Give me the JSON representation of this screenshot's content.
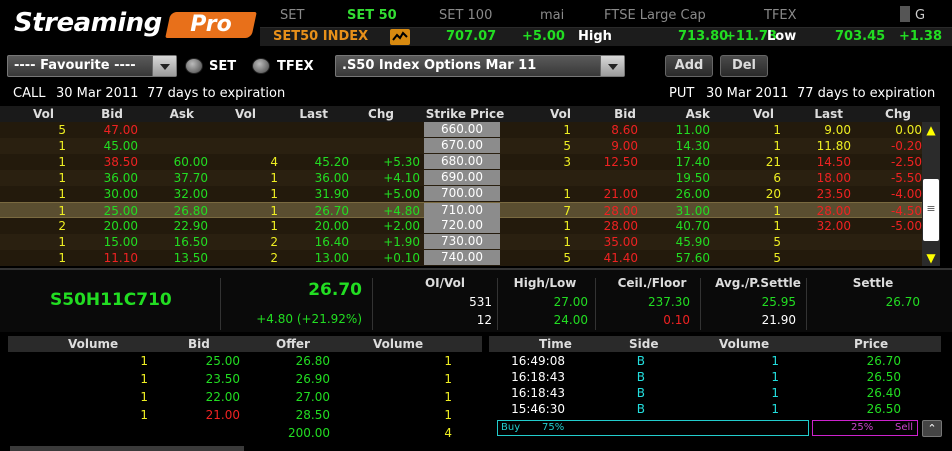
{
  "header": {
    "logo_text": "Streaming",
    "logo_pro": "Pro",
    "tabs": [
      "SET",
      "SET 50",
      "SET 100",
      "mai",
      "FTSE Large Cap",
      "TFEX"
    ],
    "corner_label": "G"
  },
  "ticker": {
    "index_name": "SET50 INDEX",
    "last": "707.07",
    "change": "+5.00",
    "high_label": "High",
    "high": "713.80",
    "high_change": "+11.73",
    "low_label": "Low",
    "low": "703.45",
    "low_change": "+1.38"
  },
  "toolbar": {
    "favourite": "---- Favourite ----",
    "radio_set": "SET",
    "radio_tfex": "TFEX",
    "series": ".S50 Index Options Mar 11",
    "add_label": "Add",
    "del_label": "Del"
  },
  "info": {
    "call_label": "CALL",
    "call_date": "30 Mar 2011",
    "call_days": "77 days to expiration",
    "put_label": "PUT",
    "put_date": "30 Mar 2011",
    "put_days": "77 days to expiration"
  },
  "chain_headers": [
    "Vol",
    "Bid",
    "Ask",
    "Vol",
    "Last",
    "Chg",
    "Strike Price",
    "Vol",
    "Bid",
    "Ask",
    "Vol",
    "Last",
    "Chg"
  ],
  "chain_rows": [
    {
      "c_vol1": "5",
      "c_bid": "47.00",
      "c_ask": "",
      "c_vol2": "",
      "c_last": "",
      "c_chg": "",
      "strike": "660.00",
      "p_vol1": "1",
      "p_bid": "8.60",
      "p_ask": "11.00",
      "p_vol2": "1",
      "p_last": "9.00",
      "p_chg": "0.00"
    },
    {
      "c_vol1": "1",
      "c_bid": "45.00",
      "c_ask": "",
      "c_vol2": "",
      "c_last": "",
      "c_chg": "",
      "strike": "670.00",
      "p_vol1": "5",
      "p_bid": "9.00",
      "p_ask": "14.30",
      "p_vol2": "1",
      "p_last": "11.80",
      "p_chg": "-0.20"
    },
    {
      "c_vol1": "1",
      "c_bid": "38.50",
      "c_ask": "60.00",
      "c_vol2": "4",
      "c_last": "45.20",
      "c_chg": "+5.30",
      "strike": "680.00",
      "p_vol1": "3",
      "p_bid": "12.50",
      "p_ask": "17.40",
      "p_vol2": "21",
      "p_last": "14.50",
      "p_chg": "-2.50"
    },
    {
      "c_vol1": "1",
      "c_bid": "36.00",
      "c_ask": "37.70",
      "c_vol2": "1",
      "c_last": "36.00",
      "c_chg": "+4.10",
      "strike": "690.00",
      "p_vol1": "",
      "p_bid": "",
      "p_ask": "19.50",
      "p_vol2": "6",
      "p_last": "18.00",
      "p_chg": "-5.50"
    },
    {
      "c_vol1": "1",
      "c_bid": "30.00",
      "c_ask": "32.00",
      "c_vol2": "1",
      "c_last": "31.90",
      "c_chg": "+5.00",
      "strike": "700.00",
      "p_vol1": "1",
      "p_bid": "21.00",
      "p_ask": "26.00",
      "p_vol2": "20",
      "p_last": "23.50",
      "p_chg": "-4.00"
    },
    {
      "c_vol1": "1",
      "c_bid": "25.00",
      "c_ask": "26.80",
      "c_vol2": "1",
      "c_last": "26.70",
      "c_chg": "+4.80",
      "strike": "710.00",
      "p_vol1": "7",
      "p_bid": "28.00",
      "p_ask": "31.00",
      "p_vol2": "1",
      "p_last": "28.00",
      "p_chg": "-4.50"
    },
    {
      "c_vol1": "2",
      "c_bid": "20.00",
      "c_ask": "22.90",
      "c_vol2": "1",
      "c_last": "20.00",
      "c_chg": "+2.00",
      "strike": "720.00",
      "p_vol1": "1",
      "p_bid": "28.00",
      "p_ask": "40.70",
      "p_vol2": "1",
      "p_last": "32.00",
      "p_chg": "-5.00"
    },
    {
      "c_vol1": "1",
      "c_bid": "15.00",
      "c_ask": "16.50",
      "c_vol2": "2",
      "c_last": "16.40",
      "c_chg": "+1.90",
      "strike": "730.00",
      "p_vol1": "1",
      "p_bid": "35.00",
      "p_ask": "45.90",
      "p_vol2": "5",
      "p_last": "",
      "p_chg": ""
    },
    {
      "c_vol1": "1",
      "c_bid": "11.10",
      "c_ask": "13.50",
      "c_vol2": "2",
      "c_last": "13.00",
      "c_chg": "+0.10",
      "strike": "740.00",
      "p_vol1": "5",
      "p_bid": "41.40",
      "p_ask": "57.60",
      "p_vol2": "5",
      "p_last": "",
      "p_chg": ""
    }
  ],
  "quote": {
    "symbol": "S50H11C710",
    "last": "26.70",
    "change": "+4.80 (+21.92%)",
    "oi_label": "OI/Vol",
    "oi": "531",
    "vol": "12",
    "hl_label": "High/Low",
    "high": "27.00",
    "low": "24.00",
    "cf_label": "Ceil./Floor",
    "ceil": "237.30",
    "floor": "0.10",
    "avg_label": "Avg./P.Settle",
    "avg": "25.95",
    "psettle": "21.90",
    "settle_label": "Settle",
    "settle": "26.70"
  },
  "depth": {
    "headers": [
      "Volume",
      "Bid",
      "Offer",
      "Volume"
    ],
    "rows": [
      {
        "bid_vol": "1",
        "bid": "25.00",
        "offer": "26.80",
        "offer_vol": "1"
      },
      {
        "bid_vol": "1",
        "bid": "23.50",
        "offer": "26.90",
        "offer_vol": "1"
      },
      {
        "bid_vol": "1",
        "bid": "22.00",
        "offer": "27.00",
        "offer_vol": "1"
      },
      {
        "bid_vol": "1",
        "bid": "21.00",
        "offer": "28.50",
        "offer_vol": "1"
      },
      {
        "bid_vol": "",
        "bid": "",
        "offer": "200.00",
        "offer_vol": "4"
      }
    ]
  },
  "trades": {
    "headers": [
      "Time",
      "Side",
      "Volume",
      "Price"
    ],
    "rows": [
      {
        "time": "16:49:08",
        "side": "B",
        "volume": "1",
        "price": "26.70"
      },
      {
        "time": "16:18:43",
        "side": "B",
        "volume": "1",
        "price": "26.50"
      },
      {
        "time": "16:18:43",
        "side": "B",
        "volume": "1",
        "price": "26.40"
      },
      {
        "time": "15:46:30",
        "side": "B",
        "volume": "1",
        "price": "26.50"
      }
    ],
    "buy_label": "Buy",
    "buy_pct": "75%",
    "sell_label": "Sell",
    "sell_pct": "25%"
  },
  "colors": {
    "up": "#22dd22",
    "down": "#ee2222",
    "accent": "#e8701a",
    "highlight_row": "#5a4e30"
  }
}
